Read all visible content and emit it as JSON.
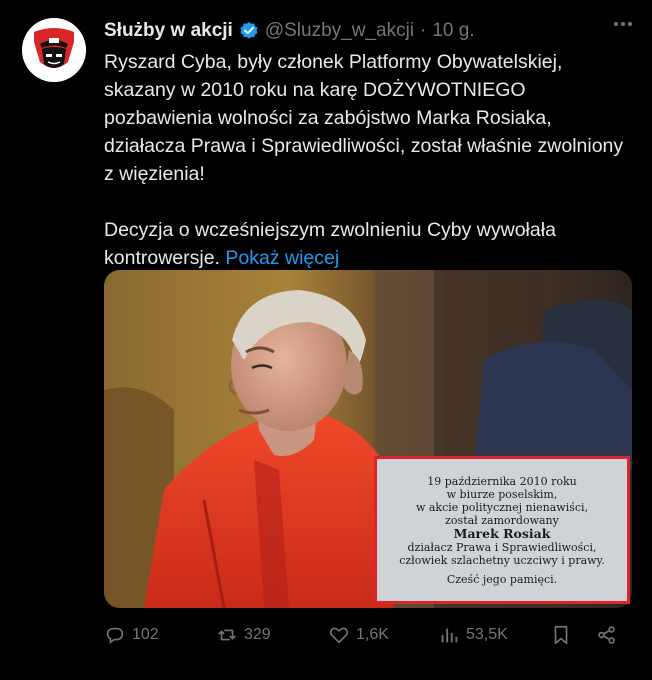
{
  "author": {
    "name": "Służby w akcji",
    "handle": "@Sluzby_w_akcji",
    "separator": "·",
    "time": "10 g."
  },
  "tweet": {
    "paragraph1": "Ryszard Cyba, były członek Platformy Obywatelskiej, skazany w 2010 roku na karę DOŻYWOTNIEGO pozbawienia wolności za zabójstwo Marka Rosiaka, działacza Prawa i Sprawiedliwości, został właśnie zwolniony z więzienia!",
    "paragraph2": "Decyzja o wcześniejszym zwolnieniu Cyby wywołała kontrowersje.",
    "show_more": "Pokaż więcej"
  },
  "media": {
    "plaque_lines": [
      "19 października 2010 roku",
      "w biurze poselskim,",
      "w akcie politycznej nienawiści,",
      "został zamordowany"
    ],
    "plaque_name": "Marek Rosiak",
    "plaque_lines2": [
      "działacz Prawa i Sprawiedliwości,",
      "człowiek szlachetny uczciwy i prawy."
    ],
    "plaque_footer": "Cześć jego pamięci."
  },
  "actions": {
    "replies": "102",
    "reposts": "329",
    "likes": "1,6K",
    "views": "53,5K"
  },
  "colors": {
    "accent": "#1d9bf0",
    "muted": "#71767b",
    "text": "#e7e9ea",
    "background": "#000000"
  },
  "icons": [
    "avatar-police-logo",
    "verified-badge-icon",
    "more-icon",
    "reply-icon",
    "repost-icon",
    "like-icon",
    "views-icon",
    "bookmark-icon",
    "share-icon"
  ]
}
